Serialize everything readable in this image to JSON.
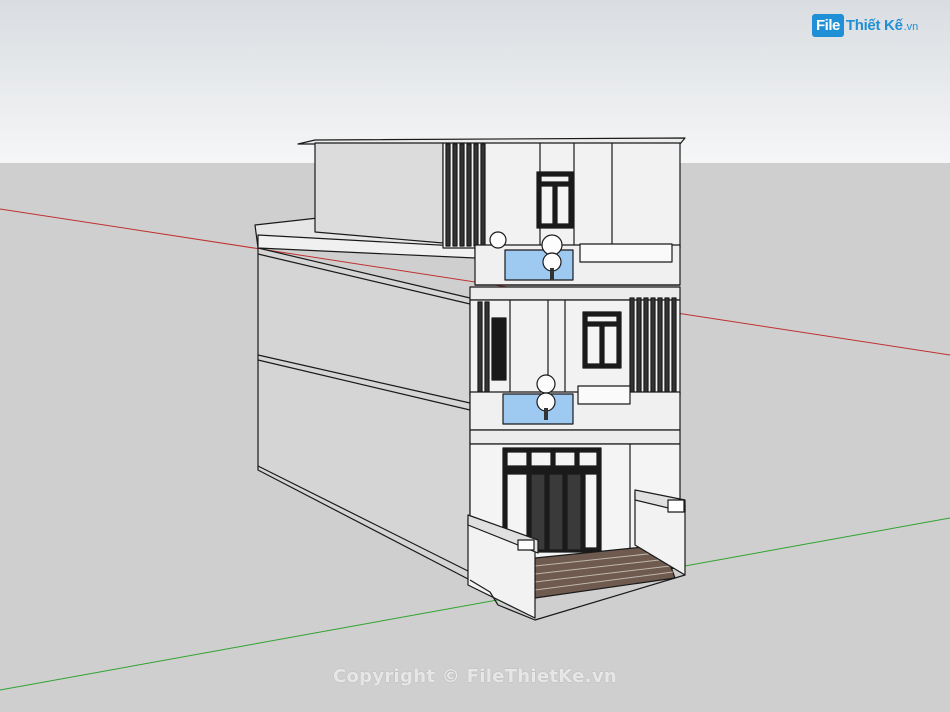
{
  "logo": {
    "badge": "File",
    "name": "Thiết Kế",
    "suffix": ".vn"
  },
  "watermark": "Copyright © FileThietKe.vn",
  "colors": {
    "sky_top": "#dde1e4",
    "sky_bottom": "#f4f5f6",
    "ground": "#cfcfcf",
    "axis_red": "#c03030",
    "axis_green": "#2fa32f",
    "wall_light": "#f2f2f2",
    "wall_side": "#d6d6d6",
    "glass": "#9ec9f0",
    "dark": "#1a1a1a",
    "wood": "#6e5a4e",
    "logo_blue": "#1f8fd6"
  }
}
